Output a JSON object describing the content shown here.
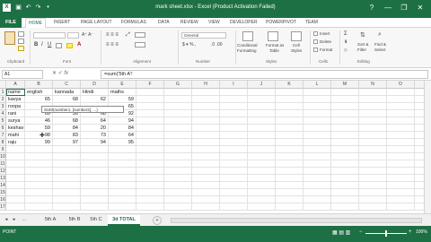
{
  "app": {
    "title": "mark sheet.xlsx - Excel (Product Activation Failed)",
    "close": "✕",
    "minimize": "—",
    "restore": "❐",
    "help": "?"
  },
  "tabs": [
    "FILE",
    "HOME",
    "INSERT",
    "PAGE LAYOUT",
    "FORMULAS",
    "DATA",
    "REVIEW",
    "VIEW",
    "DEVELOPER",
    "POWERPIVOT",
    "TEAM"
  ],
  "ribbon": {
    "clipboard_label": "Clipboard",
    "font_label": "Font",
    "alignment_label": "Alignment",
    "number_label": "Number",
    "styles_label": "Styles",
    "cells_label": "Cells",
    "editing_label": "Editing",
    "number_format": "General",
    "conditional": "Conditional",
    "formatting": "Formatting",
    "format_as": "Format as",
    "table": "Table",
    "cell": "Cell",
    "styles": "Styles",
    "insert": "Insert",
    "delete": "Delete",
    "format": "Format",
    "sort": "Sort &",
    "filter": "Filter",
    "find": "Find &",
    "select": "Select"
  },
  "formula_bar": {
    "name_box": "A1",
    "fx": "fx",
    "formula": "=sum('5th A'!"
  },
  "grid": {
    "columns": [
      "A",
      "B",
      "C",
      "D",
      "E",
      "F",
      "G",
      "H",
      "I",
      "J",
      "K",
      "L",
      "M",
      "N",
      "O",
      "P"
    ],
    "rows": [
      "1",
      "2",
      "3",
      "4",
      "5",
      "6",
      "7",
      "8",
      "9",
      "10",
      "11",
      "12",
      "13",
      "14",
      "15",
      "16",
      "17"
    ],
    "headers": [
      "name",
      "english",
      "kannada",
      "Hindi",
      "maths"
    ],
    "data": [
      [
        "kavya",
        "65",
        "68",
        "62",
        "59"
      ],
      [
        "roopa",
        "",
        "",
        "",
        "65"
      ],
      [
        "rani",
        "89",
        "30",
        "68",
        "92"
      ],
      [
        "surya",
        "46",
        "68",
        "64",
        "94"
      ],
      [
        "keshav",
        "59",
        "84",
        "20",
        "84"
      ],
      [
        "mahi",
        "98",
        "83",
        "73",
        "64"
      ],
      [
        "raju",
        "99",
        "97",
        "94",
        "95"
      ]
    ],
    "tooltip": "SUM(number1, [number2], ...)"
  },
  "sheets": {
    "tabs": [
      "5th A",
      "5th B",
      "5th C",
      "3d TOTAL"
    ],
    "active": "3d TOTAL",
    "add": "+"
  },
  "status": {
    "mode": "POINT",
    "zoom": "100%"
  }
}
